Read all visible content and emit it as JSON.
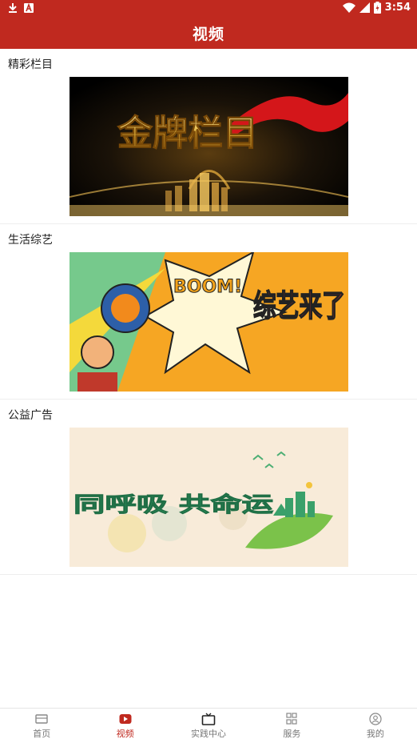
{
  "status_bar": {
    "time": "3:54"
  },
  "header": {
    "title": "视频"
  },
  "sections": [
    {
      "title": "精彩栏目",
      "banner_text": "金牌栏目"
    },
    {
      "title": "生活综艺",
      "banner_text": "综艺来了",
      "banner_sub": "BOOM!"
    },
    {
      "title": "公益广告",
      "banner_text": "同呼吸 共命运"
    }
  ],
  "nav": [
    {
      "label": "首页",
      "icon": "home-icon"
    },
    {
      "label": "视频",
      "icon": "video-play-icon",
      "active": true
    },
    {
      "label": "实践中心",
      "icon": "tv-icon"
    },
    {
      "label": "服务",
      "icon": "grid-icon"
    },
    {
      "label": "我的",
      "icon": "user-icon"
    }
  ],
  "colors": {
    "brand": "#c0291f",
    "nav_inactive": "#777777"
  }
}
